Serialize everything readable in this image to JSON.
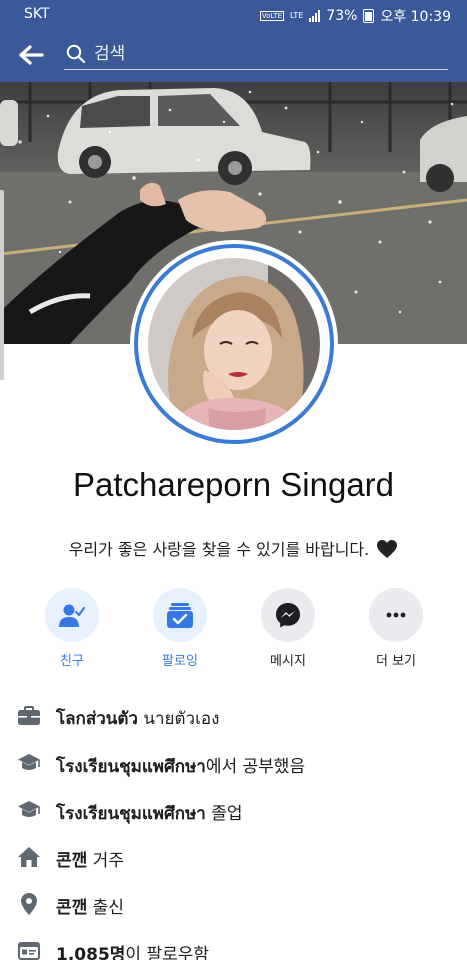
{
  "status_bar": {
    "carrier": "SKT",
    "volte": "VoLTE",
    "network": "LTE",
    "battery": "73%",
    "time": "오후 10:39"
  },
  "header": {
    "back_icon": "back-arrow-icon",
    "search_placeholder": "검색"
  },
  "profile": {
    "name": "Patchareporn Singard",
    "bio": "우리가 좋은 사랑을 찾을 수 있기를 바랍니다.",
    "bio_emoji": "black-heart-icon"
  },
  "actions": [
    {
      "label": "친구",
      "icon": "friends-check-icon"
    },
    {
      "label": "팔로잉",
      "icon": "following-icon"
    },
    {
      "label": "메시지",
      "icon": "messenger-icon"
    },
    {
      "label": "더 보기",
      "icon": "more-dots-icon"
    }
  ],
  "intro": [
    {
      "icon": "briefcase-icon",
      "bold": "โลกส่วนตัว",
      "rest": " นายตัวเอง"
    },
    {
      "icon": "graduation-cap-icon",
      "bold": "โรงเรียนชุมแพศึกษา",
      "rest": "에서 공부했음"
    },
    {
      "icon": "graduation-cap-icon",
      "bold": "โรงเรียนชุมแพศึกษา",
      "rest": " 졸업"
    },
    {
      "icon": "home-icon",
      "bold": "콘깬",
      "rest": " 거주"
    },
    {
      "icon": "location-pin-icon",
      "bold": "콘깬",
      "rest": " 출신"
    },
    {
      "icon": "followers-icon",
      "bold": "1,085명",
      "rest": "이 팔로우함"
    }
  ],
  "colors": {
    "brand": "#3b5998",
    "accent_blue": "#3578e5",
    "avatar_ring": "#3a7bd5"
  }
}
